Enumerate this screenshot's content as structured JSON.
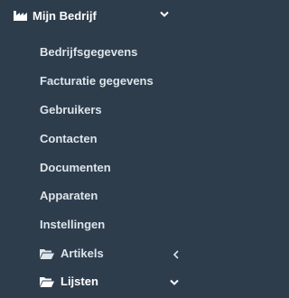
{
  "menu": {
    "header": {
      "label": "Mijn Bedrijf",
      "icon": "industry-icon",
      "expanded": true
    },
    "items": [
      {
        "label": "Bedrijfsgegevens"
      },
      {
        "label": "Facturatie gegevens"
      },
      {
        "label": "Gebruikers"
      },
      {
        "label": "Contacten"
      },
      {
        "label": "Documenten"
      },
      {
        "label": "Apparaten"
      },
      {
        "label": "Instellingen"
      },
      {
        "label": "Artikels",
        "icon": "folder-open-icon",
        "expanded": false
      },
      {
        "label": "Lijsten",
        "icon": "folder-open-icon",
        "expanded": true
      }
    ]
  },
  "colors": {
    "background": "#2e3d4c",
    "text": "#dde4ea",
    "header_text": "#ffffff"
  }
}
